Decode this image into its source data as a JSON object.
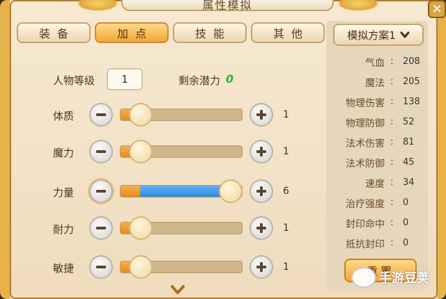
{
  "window": {
    "title": "属性模拟"
  },
  "tabs": [
    {
      "label": "装备",
      "active": false
    },
    {
      "label": "加点",
      "active": true
    },
    {
      "label": "技能",
      "active": false
    },
    {
      "label": "其他",
      "active": false
    }
  ],
  "character": {
    "level_label": "人物等级",
    "level_value": "1",
    "potential_label": "剩余潜力",
    "potential_value": "0"
  },
  "attributes": [
    {
      "label": "体质",
      "value": "1",
      "fraction": 0.0
    },
    {
      "label": "魔力",
      "value": "1",
      "fraction": 0.0
    },
    {
      "label": "力量",
      "value": "6",
      "fraction": 0.87
    },
    {
      "label": "耐力",
      "value": "1",
      "fraction": 0.0
    },
    {
      "label": "敏捷",
      "value": "1",
      "fraction": 0.0
    }
  ],
  "scheme": {
    "selected": "模拟方案1"
  },
  "stats": [
    {
      "name": "气血",
      "value": "208"
    },
    {
      "name": "魔法",
      "value": "205"
    },
    {
      "name": "物理伤害",
      "value": "138"
    },
    {
      "name": "物理防御",
      "value": "52"
    },
    {
      "name": "法术伤害",
      "value": "81"
    },
    {
      "name": "法术防御",
      "value": "45"
    },
    {
      "name": "速度",
      "value": "34"
    },
    {
      "name": "治疗强度",
      "value": "0"
    },
    {
      "name": "封印命中",
      "value": "0"
    },
    {
      "name": "抵抗封印",
      "value": "0"
    }
  ],
  "reset_label": "重置",
  "watermark": "手游豆荚",
  "colors": {
    "accent": "#f2a73a",
    "slider_fill": "#e58d1c",
    "slider_added": "#2f8ae0",
    "potential": "#2bb52b"
  },
  "icons": [
    "minus-icon",
    "plus-icon",
    "chevron-down-icon",
    "close-icon"
  ]
}
